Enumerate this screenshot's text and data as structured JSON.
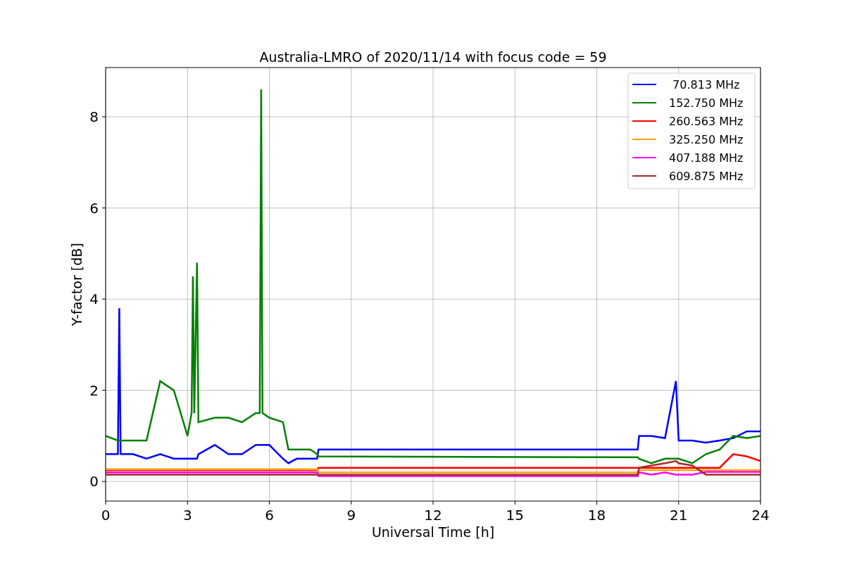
{
  "figure": {
    "chart_data": {
      "type": "line",
      "title": "Australia-LMRO of 2020/11/14 with focus code = 59",
      "xlabel": "Universal Time [h]",
      "ylabel": "Y-factor [dB]",
      "x": [
        0,
        0.45,
        0.5,
        0.55,
        1,
        1.5,
        2,
        2.5,
        3,
        3.15,
        3.2,
        3.25,
        3.35,
        3.4,
        4,
        4.5,
        5,
        5.5,
        5.65,
        5.7,
        5.75,
        6,
        6.5,
        6.7,
        7,
        7.5,
        7.75,
        7.8,
        19.5,
        19.55,
        20,
        20.5,
        20.9,
        21,
        21.5,
        22,
        22.5,
        23,
        23.5,
        24
      ],
      "series": [
        {
          "name": " 70.813 MHz",
          "color": "#0000ff",
          "values": [
            0.6,
            0.6,
            3.8,
            0.6,
            0.6,
            0.5,
            0.6,
            0.5,
            0.5,
            0.5,
            0.5,
            0.5,
            0.5,
            0.6,
            0.8,
            0.6,
            0.6,
            0.8,
            0.8,
            0.8,
            0.8,
            0.8,
            0.5,
            0.4,
            0.5,
            0.5,
            0.5,
            0.7,
            0.7,
            1.0,
            1.0,
            0.95,
            2.2,
            0.9,
            0.9,
            0.85,
            0.9,
            0.95,
            1.1,
            1.1
          ]
        },
        {
          "name": "152.750 MHz",
          "color": "#008000",
          "values": [
            1.0,
            0.9,
            0.9,
            0.9,
            0.9,
            0.9,
            2.2,
            2.0,
            1.0,
            1.5,
            4.5,
            1.5,
            4.8,
            1.3,
            1.4,
            1.4,
            1.3,
            1.5,
            1.5,
            8.6,
            1.5,
            1.4,
            1.3,
            0.7,
            0.7,
            0.7,
            0.6,
            0.55,
            0.53,
            0.5,
            0.4,
            0.5,
            0.5,
            0.5,
            0.4,
            0.6,
            0.7,
            1.0,
            0.95,
            1.0
          ]
        },
        {
          "name": "260.563 MHz",
          "color": "#ff0000",
          "values": [
            0.25,
            0.25,
            0.25,
            0.25,
            0.25,
            0.25,
            0.25,
            0.25,
            0.25,
            0.25,
            0.25,
            0.25,
            0.25,
            0.25,
            0.25,
            0.25,
            0.25,
            0.25,
            0.25,
            0.25,
            0.25,
            0.25,
            0.25,
            0.25,
            0.25,
            0.25,
            0.25,
            0.3,
            0.3,
            0.3,
            0.3,
            0.3,
            0.3,
            0.3,
            0.3,
            0.3,
            0.3,
            0.6,
            0.55,
            0.45
          ]
        },
        {
          "name": "325.250 MHz",
          "color": "#ffa500",
          "values": [
            0.27,
            0.27,
            0.27,
            0.27,
            0.27,
            0.27,
            0.27,
            0.27,
            0.27,
            0.27,
            0.27,
            0.27,
            0.27,
            0.27,
            0.27,
            0.27,
            0.27,
            0.27,
            0.27,
            0.27,
            0.27,
            0.27,
            0.27,
            0.27,
            0.27,
            0.27,
            0.27,
            0.2,
            0.2,
            0.25,
            0.25,
            0.25,
            0.25,
            0.25,
            0.25,
            0.25,
            0.25,
            0.25,
            0.25,
            0.25
          ]
        },
        {
          "name": "407.188 MHz",
          "color": "#ff00ff",
          "values": [
            0.2,
            0.2,
            0.2,
            0.2,
            0.2,
            0.2,
            0.2,
            0.2,
            0.2,
            0.2,
            0.2,
            0.2,
            0.2,
            0.2,
            0.2,
            0.2,
            0.2,
            0.2,
            0.2,
            0.2,
            0.2,
            0.2,
            0.2,
            0.2,
            0.2,
            0.2,
            0.2,
            0.12,
            0.12,
            0.2,
            0.15,
            0.2,
            0.15,
            0.15,
            0.15,
            0.21,
            0.21,
            0.21,
            0.21,
            0.21
          ]
        },
        {
          "name": "609.875 MHz",
          "color": "#a52a2a",
          "values": [
            0.15,
            0.15,
            0.15,
            0.15,
            0.15,
            0.15,
            0.15,
            0.15,
            0.15,
            0.15,
            0.15,
            0.15,
            0.15,
            0.15,
            0.15,
            0.15,
            0.15,
            0.15,
            0.15,
            0.15,
            0.15,
            0.15,
            0.15,
            0.15,
            0.15,
            0.15,
            0.15,
            0.15,
            0.15,
            0.3,
            0.35,
            0.4,
            0.45,
            0.4,
            0.35,
            0.15,
            0.15,
            0.15,
            0.15,
            0.15
          ]
        }
      ],
      "grid": true,
      "legend": true,
      "xlim": [
        0,
        24
      ],
      "ylim": [
        -0.43,
        9.08
      ],
      "xticks": [
        0,
        3,
        6,
        9,
        12,
        15,
        18,
        21,
        24
      ],
      "yticks": [
        0,
        2,
        4,
        6,
        8
      ]
    }
  }
}
